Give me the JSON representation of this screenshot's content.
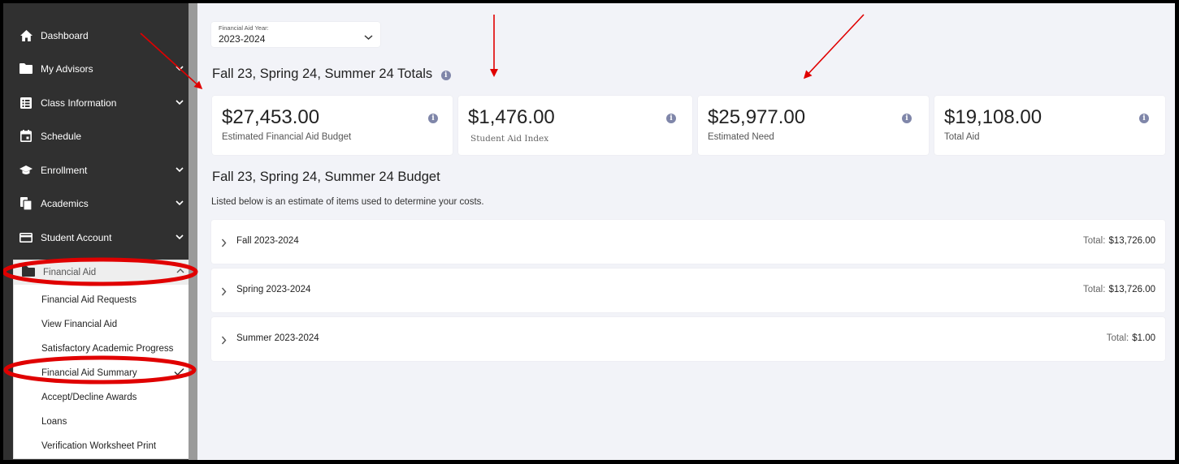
{
  "sidebar": {
    "items": [
      {
        "label": "Dashboard",
        "icon": "home-icon",
        "has_chevron": false
      },
      {
        "label": "My Advisors",
        "icon": "folder-icon",
        "has_chevron": true
      },
      {
        "label": "Class Information",
        "icon": "list-icon",
        "has_chevron": true
      },
      {
        "label": "Schedule",
        "icon": "calendar-icon",
        "has_chevron": false
      },
      {
        "label": "Enrollment",
        "icon": "graduation-cap-icon",
        "has_chevron": true
      },
      {
        "label": "Academics",
        "icon": "documents-icon",
        "has_chevron": true
      },
      {
        "label": "Student Account",
        "icon": "credit-card-icon",
        "has_chevron": true
      }
    ],
    "financial_aid": {
      "label": "Financial Aid",
      "icon": "folder-icon",
      "expanded": true,
      "items": [
        {
          "label": "Financial Aid Requests"
        },
        {
          "label": "View Financial Aid"
        },
        {
          "label": "Satisfactory Academic Progress"
        },
        {
          "label": "Financial Aid Summary",
          "selected": true
        },
        {
          "label": "Accept/Decline Awards"
        },
        {
          "label": "Loans"
        },
        {
          "label": "Verification Worksheet Print"
        }
      ]
    }
  },
  "main": {
    "year_select": {
      "label": "Financial Aid Year:",
      "value": "2023-2024"
    },
    "totals_title": "Fall 23, Spring 24, Summer 24 Totals",
    "cards": [
      {
        "amount": "$27,453.00",
        "label": "Estimated Financial Aid Budget"
      },
      {
        "amount": "$1,476.00",
        "label": "Student Aid Index"
      },
      {
        "amount": "$25,977.00",
        "label": "Estimated Need"
      },
      {
        "amount": "$19,108.00",
        "label": "Total Aid"
      }
    ],
    "budget_title": "Fall 23, Spring 24, Summer 24 Budget",
    "budget_desc": "Listed below is an estimate of items used to determine your costs.",
    "terms": [
      {
        "name": "Fall 2023-2024",
        "total_label": "Total:",
        "total": "$13,726.00"
      },
      {
        "name": "Spring 2023-2024",
        "total_label": "Total:",
        "total": "$13,726.00"
      },
      {
        "name": "Summer 2023-2024",
        "total_label": "Total:",
        "total": "$1.00"
      }
    ]
  },
  "colors": {
    "sidebar_bg": "#303030",
    "page_bg": "#f2f3f8",
    "info_icon": "#7f86a9",
    "annotation_red": "#e00000"
  }
}
